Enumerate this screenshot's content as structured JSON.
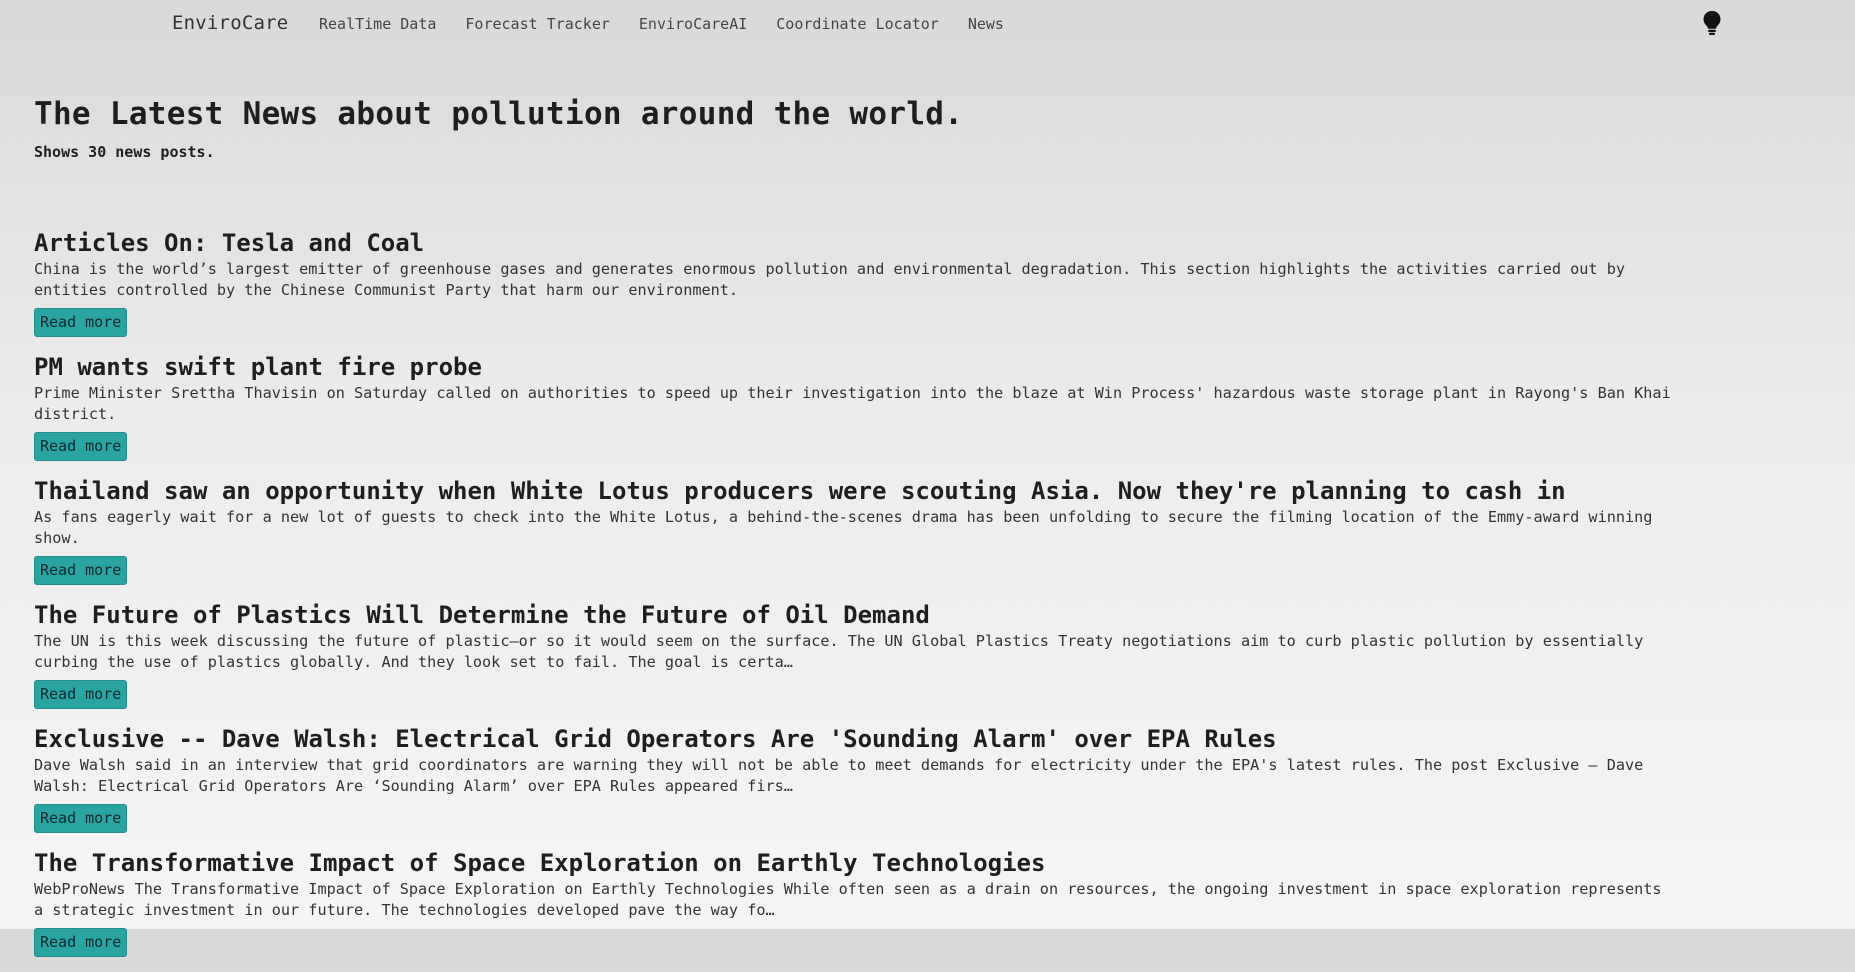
{
  "navbar": {
    "brand": "EnviroCare",
    "links": [
      {
        "label": "RealTime Data"
      },
      {
        "label": "Forecast Tracker"
      },
      {
        "label": "EnviroCareAI"
      },
      {
        "label": "Coordinate Locator"
      },
      {
        "label": "News"
      }
    ],
    "theme_toggle_icon": "lightbulb-icon"
  },
  "header": {
    "title": "The Latest News about pollution around the world.",
    "subtitle": "Shows 30 news posts."
  },
  "news": [
    {
      "title": "Articles On: Tesla and Coal",
      "description": "China is the world’s largest emitter of greenhouse gases and generates enormous pollution and environmental degradation. This section highlights the activities carried out by entities controlled by the Chinese Communist Party that harm our environment.",
      "button": "Read more"
    },
    {
      "title": "PM wants swift plant fire probe",
      "description": "Prime Minister Srettha Thavisin on Saturday called on authorities to speed up their investigation into the blaze at Win Process' hazardous waste storage plant in Rayong's Ban Khai district.",
      "button": "Read more"
    },
    {
      "title": "Thailand saw an opportunity when White Lotus producers were scouting Asia. Now they're planning to cash in",
      "description": "As fans eagerly wait for a new lot of guests to check into the White Lotus, a behind-the-scenes drama has been unfolding to secure the filming location of the Emmy-award winning show.",
      "button": "Read more"
    },
    {
      "title": "The Future of Plastics Will Determine the Future of Oil Demand",
      "description": "The UN is this week discussing the future of plastic—or so it would seem on the surface. The UN Global Plastics Treaty negotiations aim to curb plastic pollution by essentially curbing the use of plastics globally. And they look set to fail. The goal is certa…",
      "button": "Read more"
    },
    {
      "title": "Exclusive -- Dave Walsh: Electrical Grid Operators Are 'Sounding Alarm' over EPA Rules",
      "description": "Dave Walsh said in an interview that grid coordinators are warning they will not be able to meet demands for electricity under the EPA's latest rules. The post Exclusive — Dave Walsh: Electrical Grid Operators Are ‘Sounding Alarm’ over EPA Rules appeared firs…",
      "button": "Read more"
    },
    {
      "title": "The Transformative Impact of Space Exploration on Earthly Technologies",
      "description": "WebProNews The Transformative Impact of Space Exploration on Earthly Technologies While often seen as a drain on resources, the ongoing investment in space exploration represents a strategic investment in our future. The technologies developed pave the way fo…",
      "button": "Read more"
    }
  ]
}
